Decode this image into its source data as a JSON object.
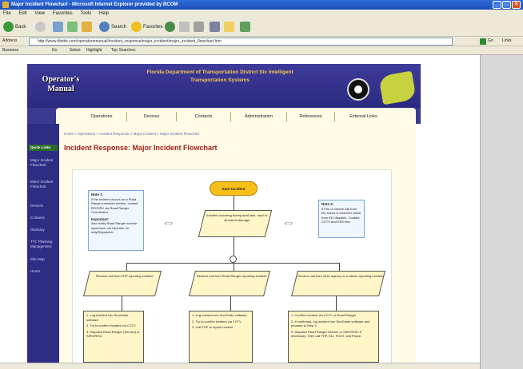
{
  "window": {
    "title": "Major Incident Flowchart - Microsoft Internet Explorer provided by BCOM",
    "minimize_glyph": "_",
    "maximize_glyph": "□",
    "close_glyph": "×"
  },
  "menubar": {
    "items": [
      "File",
      "Edit",
      "View",
      "Favorites",
      "Tools",
      "Help"
    ]
  },
  "toolbar": {
    "back_label": "Back",
    "search_label": "Search",
    "favorites_label": "Favorites"
  },
  "addressbar": {
    "label": "Address",
    "url": "http://www.fdotits.com/operatorsmanual/incident_response/major_incident/major_incident_flowchart.htm",
    "go_label": "Go",
    "links_label": "Links"
  },
  "linksbar": {
    "label": "Business",
    "items": [
      "Go",
      "Select",
      "Highlight",
      "Top Searches"
    ]
  },
  "site": {
    "manual_title": "Operator's Manual",
    "department_title": "Florida Department of Transportation District Six Intelligent Transportation Systems",
    "nav_tabs": [
      "Operations",
      "Devices",
      "Contacts",
      "Administration",
      "References",
      "External Links"
    ],
    "sidebar_header": "Quick Links",
    "sidebar_items": [
      "Major Incident Flowchart",
      "Minor Incident Flowchart",
      "Devices",
      "Contacts",
      "Glossary",
      "TTC Planning Management",
      "Site Map",
      "Home"
    ],
    "breadcrumb": "Home > Operations > Incident Response > Major Incident > Major Incident Flowchart",
    "page_heading": "Incident Response: Major Incident Flowchart"
  },
  "flowchart": {
    "start": "Start Incident",
    "note1_title": "Note 1:",
    "note1_text": "If the incident occurs on a Road Ranger patrolled section, contact RR/SIRV via Road Ranger Coordinator.",
    "note1_important_title": "Important:",
    "note1_important_text": "Also notify Road Ranger service supervisor via Operator on duty/Dispatcher.",
    "note2_title": "Note 2:",
    "note2_text": "If Fire or rescue call from the scene is received check from 911 dispatch. Contact CCTV and ESS first.",
    "decision": "Incident occurring during dual lane, road or structural damage",
    "branch1": "Receive call from FHP reporting incident",
    "branch2": "Receive call from Road Ranger reporting incident",
    "branch3": "Receive call from other agency or a citizen reporting incident",
    "box1": [
      "1. Log incident into SunGuide software",
      "2. Try to confirm incident via CCTV",
      "3. Dispatch Road Ranger (Service) or SIRV/RISC"
    ],
    "box2": [
      "1. Log incident into SunGuide software",
      "2. Try to confirm incident via CCTV",
      "3. Call FHP to report incident"
    ],
    "box3": [
      "1. Confirm incident via CCTV or Road Ranger",
      "2. If confirmed, log incident into SunGuide software and proceed to Step 3",
      "3. Dispatch Road Ranger Service or SIRV/RISC if necessary. Then call FHP, 911, FDOT, and Police."
    ]
  }
}
